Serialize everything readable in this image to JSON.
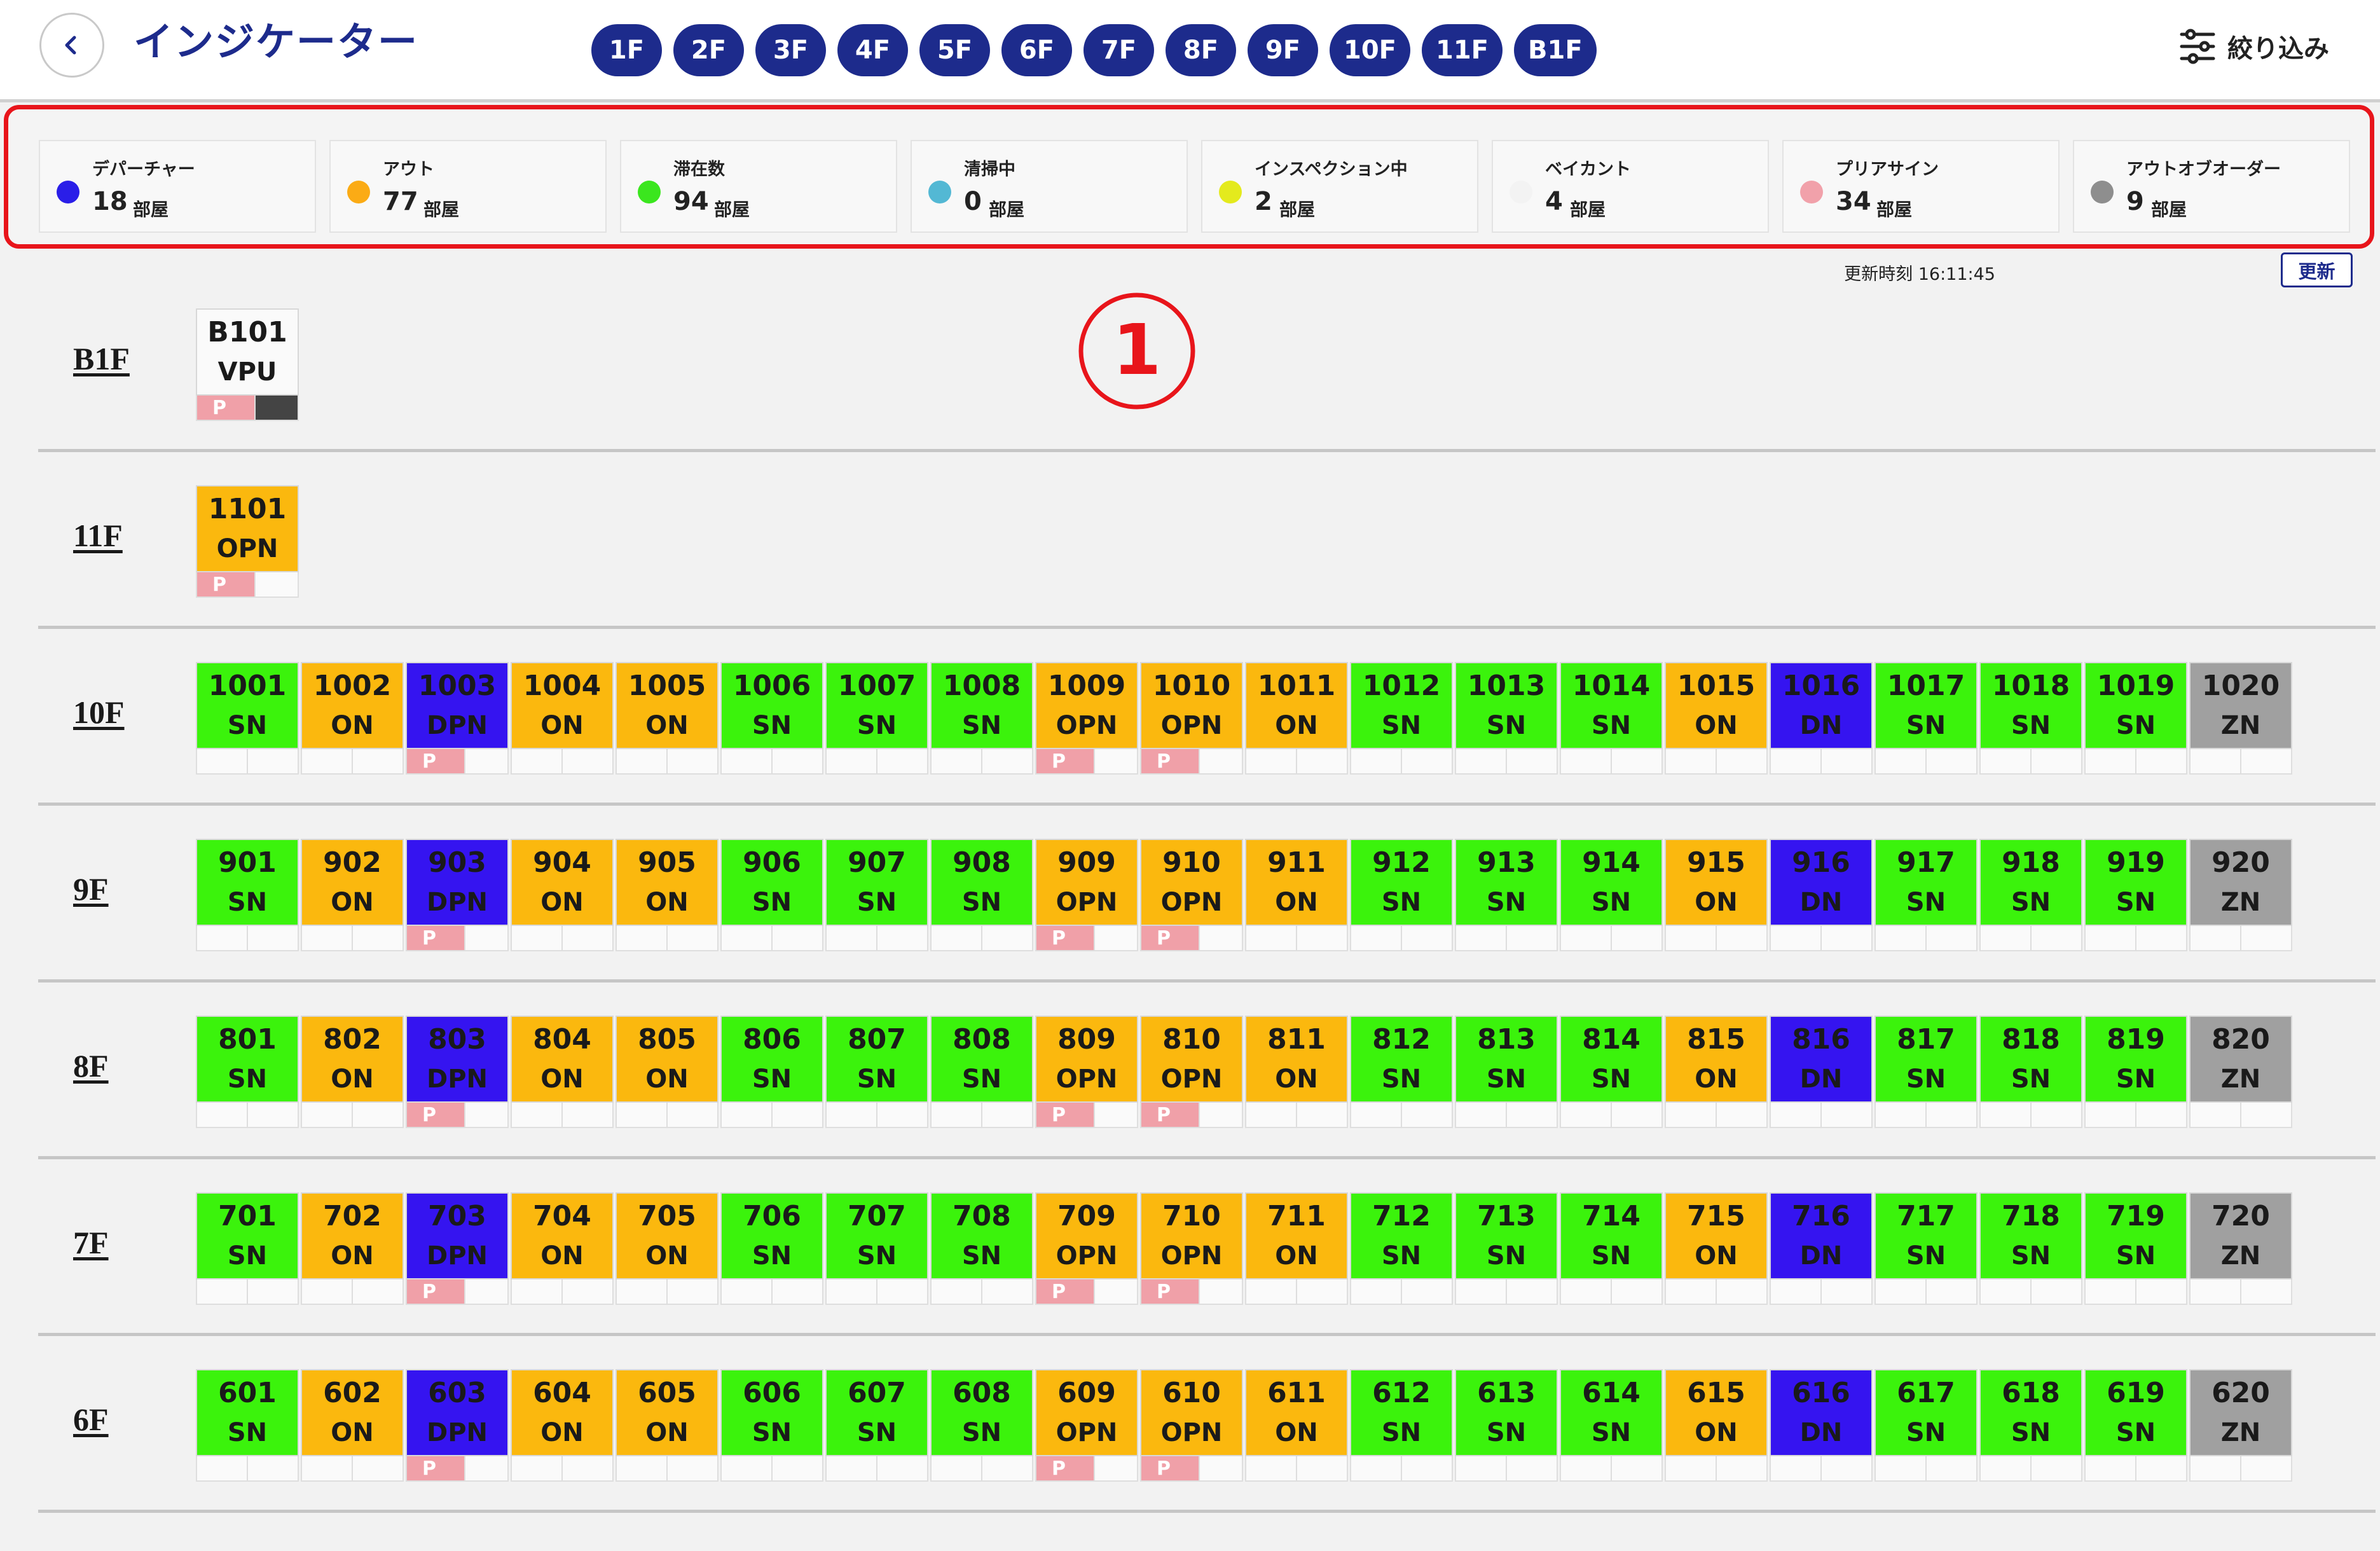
{
  "header": {
    "back_icon": "chevron-left-icon",
    "title": "インジケーター",
    "floor_tabs": [
      "1F",
      "2F",
      "3F",
      "4F",
      "5F",
      "6F",
      "7F",
      "8F",
      "9F",
      "10F",
      "11F",
      "B1F"
    ],
    "filter_icon": "sliders-icon",
    "filter_label": "絞り込み"
  },
  "summary": {
    "unit": "部屋",
    "items": [
      {
        "label": "デパーチャー",
        "count": "18",
        "color": "#2a1ee8"
      },
      {
        "label": "アウト",
        "count": "77",
        "color": "#fbab15"
      },
      {
        "label": "滞在数",
        "count": "94",
        "color": "#3be61e"
      },
      {
        "label": "清掃中",
        "count": "0",
        "color": "#53b8d4"
      },
      {
        "label": "インスペクション中",
        "count": "2",
        "color": "#e4ea1d"
      },
      {
        "label": "ベイカント",
        "count": "4",
        "color": "#f3f3f3"
      },
      {
        "label": "プリアサイン",
        "count": "34",
        "color": "#f1a1aa"
      },
      {
        "label": "アウトオブオーダー",
        "count": "9",
        "color": "#8e8e8e"
      }
    ]
  },
  "update": {
    "time_text": "更新時刻 16:11:45",
    "button_label": "更新"
  },
  "annotation": "①",
  "status_colors": {
    "SN": "#3bf30c",
    "ON": "#fbb80e",
    "OPN": "#fbb80e",
    "DPN": "#3514f0",
    "DN": "#3514f0",
    "ZN": "#a0a0a0",
    "VPU": "#fafafa"
  },
  "flag_label": "P",
  "floors": [
    {
      "label": "B1F",
      "rooms": [
        {
          "number": "B101",
          "status": "VPU",
          "flags": [
            "P",
            "dark"
          ]
        }
      ]
    },
    {
      "label": "11F",
      "rooms": [
        {
          "number": "1101",
          "status": "OPN",
          "flags": [
            "P",
            ""
          ]
        }
      ]
    },
    {
      "label": "10F",
      "rooms": [
        {
          "number": "1001",
          "status": "SN",
          "flags": [
            "",
            ""
          ]
        },
        {
          "number": "1002",
          "status": "ON",
          "flags": [
            "",
            ""
          ]
        },
        {
          "number": "1003",
          "status": "DPN",
          "flags": [
            "P",
            ""
          ]
        },
        {
          "number": "1004",
          "status": "ON",
          "flags": [
            "",
            ""
          ]
        },
        {
          "number": "1005",
          "status": "ON",
          "flags": [
            "",
            ""
          ]
        },
        {
          "number": "1006",
          "status": "SN",
          "flags": [
            "",
            ""
          ]
        },
        {
          "number": "1007",
          "status": "SN",
          "flags": [
            "",
            ""
          ]
        },
        {
          "number": "1008",
          "status": "SN",
          "flags": [
            "",
            ""
          ]
        },
        {
          "number": "1009",
          "status": "OPN",
          "flags": [
            "P",
            ""
          ]
        },
        {
          "number": "1010",
          "status": "OPN",
          "flags": [
            "P",
            ""
          ]
        },
        {
          "number": "1011",
          "status": "ON",
          "flags": [
            "",
            ""
          ]
        },
        {
          "number": "1012",
          "status": "SN",
          "flags": [
            "",
            ""
          ]
        },
        {
          "number": "1013",
          "status": "SN",
          "flags": [
            "",
            ""
          ]
        },
        {
          "number": "1014",
          "status": "SN",
          "flags": [
            "",
            ""
          ]
        },
        {
          "number": "1015",
          "status": "ON",
          "flags": [
            "",
            ""
          ]
        },
        {
          "number": "1016",
          "status": "DN",
          "flags": [
            "",
            ""
          ]
        },
        {
          "number": "1017",
          "status": "SN",
          "flags": [
            "",
            ""
          ]
        },
        {
          "number": "1018",
          "status": "SN",
          "flags": [
            "",
            ""
          ]
        },
        {
          "number": "1019",
          "status": "SN",
          "flags": [
            "",
            ""
          ]
        },
        {
          "number": "1020",
          "status": "ZN",
          "flags": [
            "",
            ""
          ]
        }
      ]
    },
    {
      "label": "9F",
      "rooms": [
        {
          "number": "901",
          "status": "SN",
          "flags": [
            "",
            ""
          ]
        },
        {
          "number": "902",
          "status": "ON",
          "flags": [
            "",
            ""
          ]
        },
        {
          "number": "903",
          "status": "DPN",
          "flags": [
            "P",
            ""
          ]
        },
        {
          "number": "904",
          "status": "ON",
          "flags": [
            "",
            ""
          ]
        },
        {
          "number": "905",
          "status": "ON",
          "flags": [
            "",
            ""
          ]
        },
        {
          "number": "906",
          "status": "SN",
          "flags": [
            "",
            ""
          ]
        },
        {
          "number": "907",
          "status": "SN",
          "flags": [
            "",
            ""
          ]
        },
        {
          "number": "908",
          "status": "SN",
          "flags": [
            "",
            ""
          ]
        },
        {
          "number": "909",
          "status": "OPN",
          "flags": [
            "P",
            ""
          ]
        },
        {
          "number": "910",
          "status": "OPN",
          "flags": [
            "P",
            ""
          ]
        },
        {
          "number": "911",
          "status": "ON",
          "flags": [
            "",
            ""
          ]
        },
        {
          "number": "912",
          "status": "SN",
          "flags": [
            "",
            ""
          ]
        },
        {
          "number": "913",
          "status": "SN",
          "flags": [
            "",
            ""
          ]
        },
        {
          "number": "914",
          "status": "SN",
          "flags": [
            "",
            ""
          ]
        },
        {
          "number": "915",
          "status": "ON",
          "flags": [
            "",
            ""
          ]
        },
        {
          "number": "916",
          "status": "DN",
          "flags": [
            "",
            ""
          ]
        },
        {
          "number": "917",
          "status": "SN",
          "flags": [
            "",
            ""
          ]
        },
        {
          "number": "918",
          "status": "SN",
          "flags": [
            "",
            ""
          ]
        },
        {
          "number": "919",
          "status": "SN",
          "flags": [
            "",
            ""
          ]
        },
        {
          "number": "920",
          "status": "ZN",
          "flags": [
            "",
            ""
          ]
        }
      ]
    },
    {
      "label": "8F",
      "rooms": [
        {
          "number": "801",
          "status": "SN",
          "flags": [
            "",
            ""
          ]
        },
        {
          "number": "802",
          "status": "ON",
          "flags": [
            "",
            ""
          ]
        },
        {
          "number": "803",
          "status": "DPN",
          "flags": [
            "P",
            ""
          ]
        },
        {
          "number": "804",
          "status": "ON",
          "flags": [
            "",
            ""
          ]
        },
        {
          "number": "805",
          "status": "ON",
          "flags": [
            "",
            ""
          ]
        },
        {
          "number": "806",
          "status": "SN",
          "flags": [
            "",
            ""
          ]
        },
        {
          "number": "807",
          "status": "SN",
          "flags": [
            "",
            ""
          ]
        },
        {
          "number": "808",
          "status": "SN",
          "flags": [
            "",
            ""
          ]
        },
        {
          "number": "809",
          "status": "OPN",
          "flags": [
            "P",
            ""
          ]
        },
        {
          "number": "810",
          "status": "OPN",
          "flags": [
            "P",
            ""
          ]
        },
        {
          "number": "811",
          "status": "ON",
          "flags": [
            "",
            ""
          ]
        },
        {
          "number": "812",
          "status": "SN",
          "flags": [
            "",
            ""
          ]
        },
        {
          "number": "813",
          "status": "SN",
          "flags": [
            "",
            ""
          ]
        },
        {
          "number": "814",
          "status": "SN",
          "flags": [
            "",
            ""
          ]
        },
        {
          "number": "815",
          "status": "ON",
          "flags": [
            "",
            ""
          ]
        },
        {
          "number": "816",
          "status": "DN",
          "flags": [
            "",
            ""
          ]
        },
        {
          "number": "817",
          "status": "SN",
          "flags": [
            "",
            ""
          ]
        },
        {
          "number": "818",
          "status": "SN",
          "flags": [
            "",
            ""
          ]
        },
        {
          "number": "819",
          "status": "SN",
          "flags": [
            "",
            ""
          ]
        },
        {
          "number": "820",
          "status": "ZN",
          "flags": [
            "",
            ""
          ]
        }
      ]
    },
    {
      "label": "7F",
      "rooms": [
        {
          "number": "701",
          "status": "SN",
          "flags": [
            "",
            ""
          ]
        },
        {
          "number": "702",
          "status": "ON",
          "flags": [
            "",
            ""
          ]
        },
        {
          "number": "703",
          "status": "DPN",
          "flags": [
            "P",
            ""
          ]
        },
        {
          "number": "704",
          "status": "ON",
          "flags": [
            "",
            ""
          ]
        },
        {
          "number": "705",
          "status": "ON",
          "flags": [
            "",
            ""
          ]
        },
        {
          "number": "706",
          "status": "SN",
          "flags": [
            "",
            ""
          ]
        },
        {
          "number": "707",
          "status": "SN",
          "flags": [
            "",
            ""
          ]
        },
        {
          "number": "708",
          "status": "SN",
          "flags": [
            "",
            ""
          ]
        },
        {
          "number": "709",
          "status": "OPN",
          "flags": [
            "P",
            ""
          ]
        },
        {
          "number": "710",
          "status": "OPN",
          "flags": [
            "P",
            ""
          ]
        },
        {
          "number": "711",
          "status": "ON",
          "flags": [
            "",
            ""
          ]
        },
        {
          "number": "712",
          "status": "SN",
          "flags": [
            "",
            ""
          ]
        },
        {
          "number": "713",
          "status": "SN",
          "flags": [
            "",
            ""
          ]
        },
        {
          "number": "714",
          "status": "SN",
          "flags": [
            "",
            ""
          ]
        },
        {
          "number": "715",
          "status": "ON",
          "flags": [
            "",
            ""
          ]
        },
        {
          "number": "716",
          "status": "DN",
          "flags": [
            "",
            ""
          ]
        },
        {
          "number": "717",
          "status": "SN",
          "flags": [
            "",
            ""
          ]
        },
        {
          "number": "718",
          "status": "SN",
          "flags": [
            "",
            ""
          ]
        },
        {
          "number": "719",
          "status": "SN",
          "flags": [
            "",
            ""
          ]
        },
        {
          "number": "720",
          "status": "ZN",
          "flags": [
            "",
            ""
          ]
        }
      ]
    },
    {
      "label": "6F",
      "rooms": [
        {
          "number": "601",
          "status": "SN",
          "flags": [
            "",
            ""
          ]
        },
        {
          "number": "602",
          "status": "ON",
          "flags": [
            "",
            ""
          ]
        },
        {
          "number": "603",
          "status": "DPN",
          "flags": [
            "P",
            ""
          ]
        },
        {
          "number": "604",
          "status": "ON",
          "flags": [
            "",
            ""
          ]
        },
        {
          "number": "605",
          "status": "ON",
          "flags": [
            "",
            ""
          ]
        },
        {
          "number": "606",
          "status": "SN",
          "flags": [
            "",
            ""
          ]
        },
        {
          "number": "607",
          "status": "SN",
          "flags": [
            "",
            ""
          ]
        },
        {
          "number": "608",
          "status": "SN",
          "flags": [
            "",
            ""
          ]
        },
        {
          "number": "609",
          "status": "OPN",
          "flags": [
            "P",
            ""
          ]
        },
        {
          "number": "610",
          "status": "OPN",
          "flags": [
            "P",
            ""
          ]
        },
        {
          "number": "611",
          "status": "ON",
          "flags": [
            "",
            ""
          ]
        },
        {
          "number": "612",
          "status": "SN",
          "flags": [
            "",
            ""
          ]
        },
        {
          "number": "613",
          "status": "SN",
          "flags": [
            "",
            ""
          ]
        },
        {
          "number": "614",
          "status": "SN",
          "flags": [
            "",
            ""
          ]
        },
        {
          "number": "615",
          "status": "ON",
          "flags": [
            "",
            ""
          ]
        },
        {
          "number": "616",
          "status": "DN",
          "flags": [
            "",
            ""
          ]
        },
        {
          "number": "617",
          "status": "SN",
          "flags": [
            "",
            ""
          ]
        },
        {
          "number": "618",
          "status": "SN",
          "flags": [
            "",
            ""
          ]
        },
        {
          "number": "619",
          "status": "SN",
          "flags": [
            "",
            ""
          ]
        },
        {
          "number": "620",
          "status": "ZN",
          "flags": [
            "",
            ""
          ]
        }
      ]
    }
  ]
}
